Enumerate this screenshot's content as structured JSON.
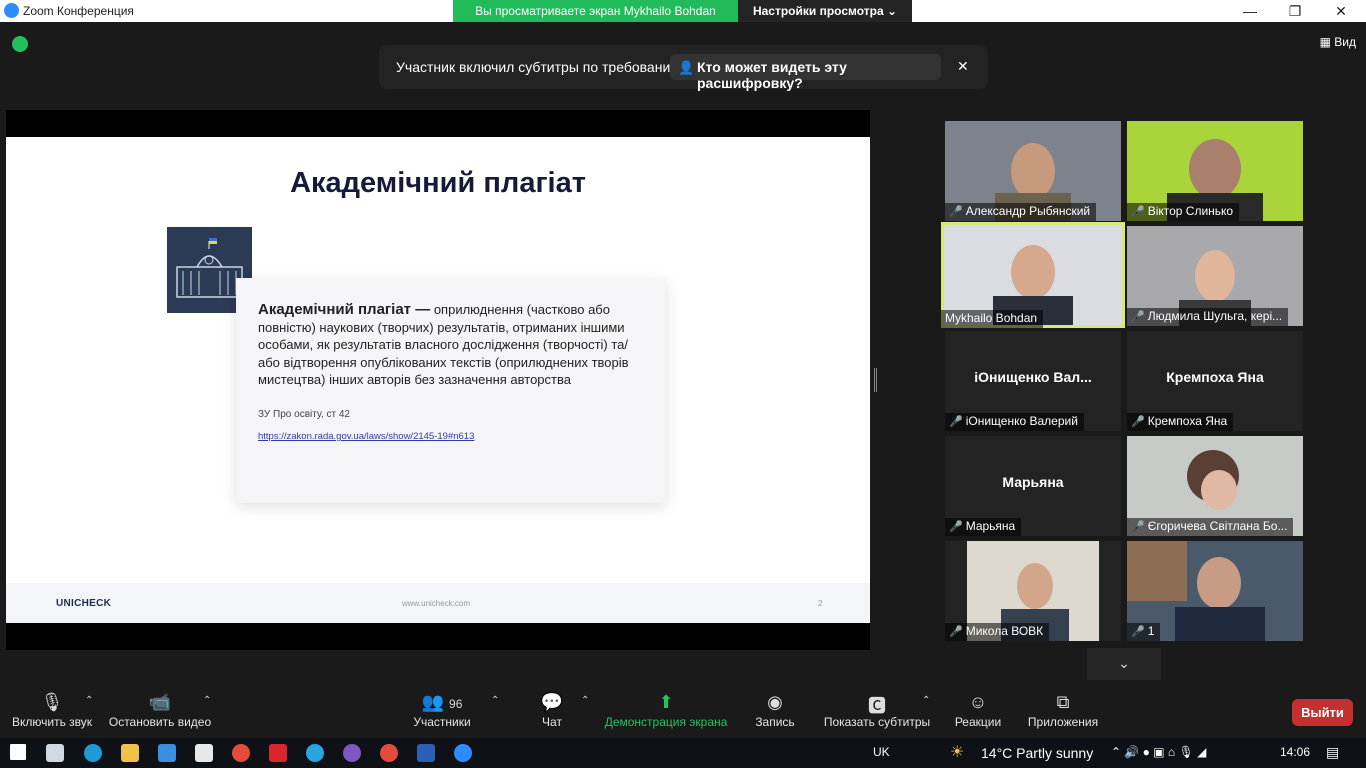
{
  "window": {
    "title": "Zoom Конференция",
    "minimize": "—",
    "restore": "❐",
    "close": "✕"
  },
  "share": {
    "banner": "Вы просматриваете экран Mykhailo Bohdan",
    "view_options": "Настройки просмотра ⌄"
  },
  "view_button": "▦ Вид",
  "captions": {
    "text": "Участник включил субтитры по требованию",
    "who_can_see": "Кто может видеть эту расшифровку?",
    "close": "✕"
  },
  "slide": {
    "title": "Академічний плагіат",
    "def_bold": "Академічний плагіат —",
    "def_text": " оприлюднення (частково або повністю) наукових (творчих) результатів, отриманих іншими особами, як результатів власного дослідження (творчості) та/або відтворення опублікованих текстів (оприлюднених творів мистецтва) інших авторів без зазначення авторства",
    "law": "ЗУ Про освіту, ст 42",
    "link": "https://zakon.rada.gov.ua/laws/show/2145-19#n613",
    "logo": "UNICHECK",
    "footer_url": "www.unicheck.com",
    "page": "2"
  },
  "participants": [
    {
      "name": "Александр Рыбянский",
      "muted": true,
      "video": true
    },
    {
      "name": "Віктор Слинько",
      "muted": true,
      "video": true
    },
    {
      "name": "Mykhailo Bohdan",
      "muted": false,
      "video": true,
      "active": true
    },
    {
      "name": "Людмила Шульга, кері...",
      "muted": true,
      "video": true
    },
    {
      "name": "іОнищенко Валерий",
      "big": "іОнищенко  Вал...",
      "muted": true,
      "video": false
    },
    {
      "name": "Кремпоха Яна",
      "big": "Кремпоха Яна",
      "muted": true,
      "video": false
    },
    {
      "name": "Марьяна",
      "big": "Марьяна",
      "muted": true,
      "video": false
    },
    {
      "name": "Єгоричева Світлана Бо...",
      "muted": true,
      "video": true
    },
    {
      "name": "Микола ВОВК",
      "muted": true,
      "video": true
    },
    {
      "name": "1",
      "muted": true,
      "video": true
    }
  ],
  "toolbar": {
    "unmute": "Включить звук",
    "stop_video": "Остановить видео",
    "participants": "Участники",
    "participants_count": "96",
    "chat": "Чат",
    "share_screen": "Демонстрация экрана",
    "record": "Запись",
    "captions": "Показать субтитры",
    "reactions": "Реакции",
    "apps": "Приложения",
    "leave": "Выйти"
  },
  "taskbar": {
    "lang": "UK",
    "weather": "14°C  Partly sunny",
    "time": "14:06"
  }
}
